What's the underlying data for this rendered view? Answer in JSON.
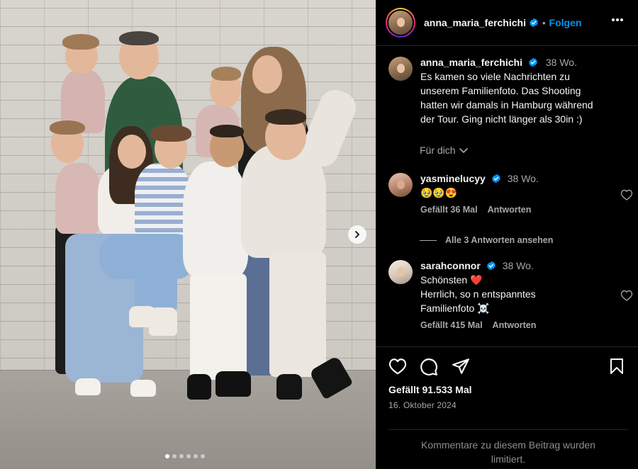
{
  "post": {
    "username": "anna_maria_ferchichi",
    "separator": "•",
    "follow_label": "Folgen",
    "more_icon": "more-horizontal-icon",
    "carousel": {
      "slide_count": 6,
      "active_index": 0
    }
  },
  "caption": {
    "username": "anna_maria_ferchichi",
    "time": "38 Wo.",
    "lines": [
      "Es kamen so viele Nachrichten zu",
      "unserem Familienfoto. Das Shooting",
      "hatten wir damals in Hamburg während",
      "der Tour. Ging nicht länger als 30in :)"
    ],
    "for_you_label": "Für dich"
  },
  "comments": [
    {
      "username": "yasminelucyy",
      "time": "38 Wo.",
      "lines": [
        "🥹🥹😍"
      ],
      "likes": "Gefällt 36 Mal",
      "reply_label": "Antworten"
    },
    {
      "username": "sarahconnor",
      "time": "38 Wo.",
      "lines": [
        "Schönsten ❤️",
        "Herrlich, so n entspanntes",
        "Familienfoto ☠️"
      ],
      "likes": "Gefällt 415 Mal",
      "reply_label": "Antworten"
    }
  ],
  "view_replies_label": "Alle 3 Antworten ansehen",
  "footer": {
    "likes": "Gefällt 91.533 Mal",
    "date": "16. Oktober 2024",
    "comments_off_line1": "Kommentare zu diesem Beitrag wurden",
    "comments_off_line2": "limitiert."
  },
  "colors": {
    "background": "#000000",
    "text": "#f5f5f5",
    "muted": "#a8a8a8",
    "link_blue": "#0095f6",
    "verified_blue": "#0095f6",
    "heart_red": "#ff3040"
  }
}
